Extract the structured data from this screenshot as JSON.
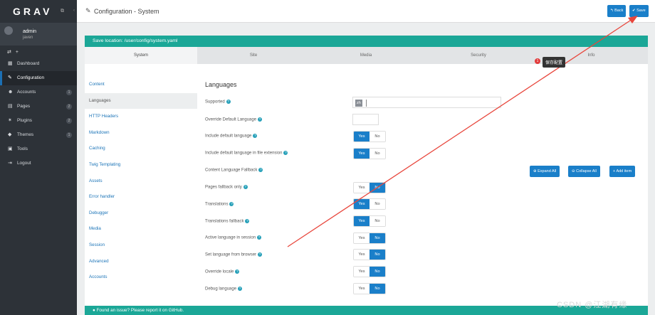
{
  "sidebar": {
    "logo": "GRAV",
    "user": {
      "name": "admin",
      "subtitle": "javen"
    },
    "nav": [
      {
        "label": "Dashboard",
        "icon": "dashboard-icon",
        "glyph": "▦",
        "badge": ""
      },
      {
        "label": "Configuration",
        "icon": "wrench-icon",
        "glyph": "🔧",
        "badge": "",
        "active": true
      },
      {
        "label": "Accounts",
        "icon": "users-icon",
        "glyph": "👥",
        "badge": "1"
      },
      {
        "label": "Pages",
        "icon": "file-icon",
        "glyph": "▤",
        "badge": "2"
      },
      {
        "label": "Plugins",
        "icon": "plug-icon",
        "glyph": "✶",
        "badge": "2"
      },
      {
        "label": "Themes",
        "icon": "tint-icon",
        "glyph": "◆",
        "badge": "1"
      },
      {
        "label": "Tools",
        "icon": "briefcase-icon",
        "glyph": "▣",
        "badge": ""
      },
      {
        "label": "Logout",
        "icon": "sign-out-icon",
        "glyph": "⇥",
        "badge": ""
      }
    ]
  },
  "header": {
    "title": "Configuration - System",
    "back_label": "Back",
    "save_label": "Save"
  },
  "save_location": "Save location: /user/config/system.yaml",
  "tabs": [
    "System",
    "Site",
    "Media",
    "Security",
    "Info"
  ],
  "tooltip": {
    "number": "1",
    "text": "保存配置"
  },
  "subnav": [
    "Content",
    "Languages",
    "HTTP Headers",
    "Markdown",
    "Caching",
    "Twig Templating",
    "Assets",
    "Error handler",
    "Debugger",
    "Media",
    "Session",
    "Advanced",
    "Accounts"
  ],
  "section_title": "Languages",
  "fields": {
    "supported": {
      "label": "Supported",
      "value": "zh"
    },
    "override_default": {
      "label": "Override Default Language"
    },
    "include_default": {
      "label": "Include default language"
    },
    "include_default_ext": {
      "label": "Include default language in file extension"
    },
    "fallback": {
      "label": "Content Language Fallback"
    },
    "pages_fallback": {
      "label": "Pages fallback only"
    },
    "translations": {
      "label": "Translations"
    },
    "translations_fallback": {
      "label": "Translations fallback"
    },
    "active_session": {
      "label": "Active language in session"
    },
    "from_browser": {
      "label": "Set language from browser"
    },
    "override_locale": {
      "label": "Override locale"
    },
    "debug_language": {
      "label": "Debug language"
    }
  },
  "toggle_labels": {
    "yes": "Yes",
    "no": "No"
  },
  "fallback_buttons": {
    "expand": "Expand All",
    "collapse": "Collapse All",
    "add": "Add item"
  },
  "footer": "Found an issue? Please report it on GitHub.",
  "watermark": "CSDN @江湖有缘",
  "colors": {
    "accent": "#1a7fc9",
    "teal": "#1ba797",
    "sidebar": "#2d3238",
    "annotation_arrow": "#e8463c"
  }
}
